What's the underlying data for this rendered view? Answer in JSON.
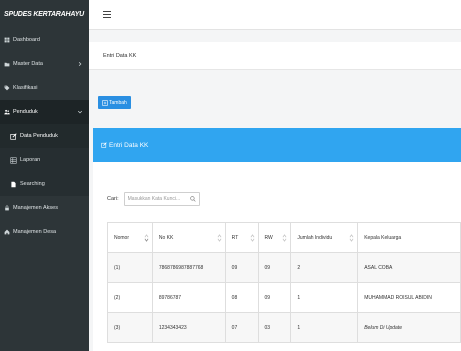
{
  "app": {
    "brand": "SPUDES KERTARAHAYU"
  },
  "sidebar": {
    "items": [
      {
        "label": "Dashboard",
        "icon": "dashboard-icon"
      },
      {
        "label": "Master Data",
        "icon": "folder-icon",
        "caret": true
      },
      {
        "label": "Klasifikasi",
        "icon": "tag-icon"
      },
      {
        "label": "Penduduk",
        "icon": "users-icon",
        "caret": true,
        "active": true
      },
      {
        "label": "Data Penduduk",
        "icon": "edit-icon",
        "sub": true,
        "current": true
      },
      {
        "label": "Laporan",
        "icon": "report-icon",
        "sub": true
      },
      {
        "label": "Searching",
        "icon": "file-icon",
        "sub": true
      },
      {
        "label": "Manajemen Akses",
        "icon": "lock-icon"
      },
      {
        "label": "Manajemen Desa",
        "icon": "home-icon"
      }
    ]
  },
  "header": {
    "breadcrumb": "Entri Data KK"
  },
  "toolbar": {
    "add_label": "Tambah"
  },
  "panel": {
    "title": "Entri Data KK"
  },
  "search": {
    "label": "Cari:",
    "placeholder": "Masukkan Kata Kunci..."
  },
  "table": {
    "columns": [
      "Nomor",
      "No KK",
      "RT",
      "RW",
      "Jumlah Individu",
      "Kepala Keluarga"
    ],
    "rows": [
      {
        "nomor": "(1)",
        "nokk": "7868786987887768",
        "rt": "09",
        "rw": "09",
        "jumlah": "2",
        "kepala": "ASAL COBA",
        "italic": false
      },
      {
        "nomor": "(2)",
        "nokk": "89786787",
        "rt": "08",
        "rw": "09",
        "jumlah": "1",
        "kepala": "MUHAMMAD ROISUL ABIDIN",
        "italic": false
      },
      {
        "nomor": "(3)",
        "nokk": "1234343423",
        "rt": "07",
        "rw": "03",
        "jumlah": "1",
        "kepala": "Belum Di Update",
        "italic": true
      }
    ]
  },
  "colors": {
    "sidebar_bg": "#2d3538",
    "accent": "#30a5f0",
    "button": "#2a8fe2"
  }
}
